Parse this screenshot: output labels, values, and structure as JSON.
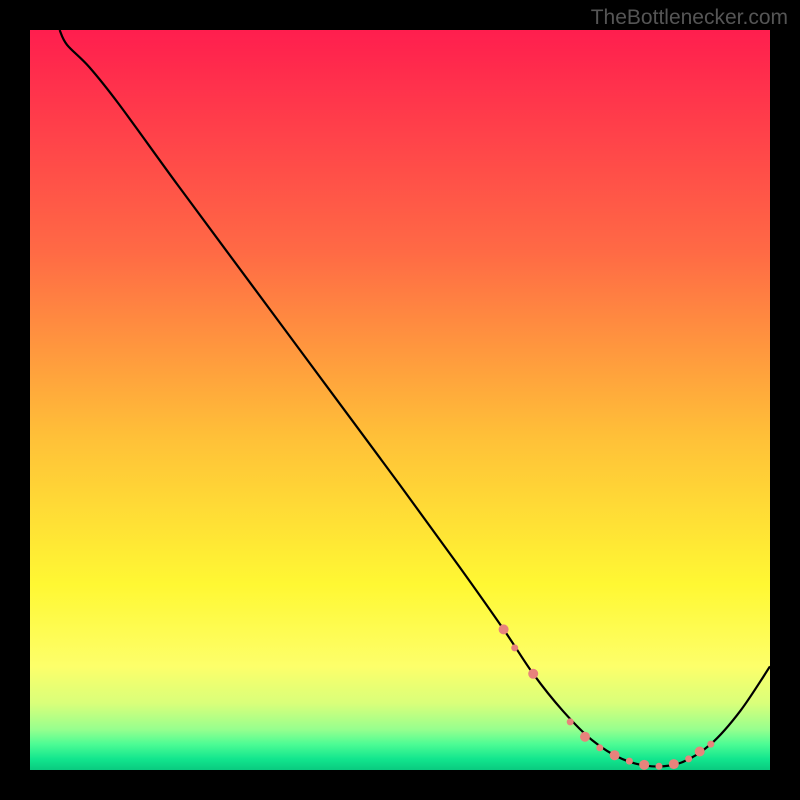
{
  "watermark": "TheBottlenecker.com",
  "chart_data": {
    "type": "line",
    "title": "",
    "xlabel": "",
    "ylabel": "",
    "xlim": [
      0,
      100
    ],
    "ylim": [
      0,
      100
    ],
    "series": [
      {
        "name": "bottleneck-curve",
        "color": "#000000",
        "x": [
          4,
          5,
          8,
          12,
          20,
          30,
          40,
          50,
          58,
          64,
          68,
          72,
          76,
          80,
          84,
          88,
          92,
          96,
          100
        ],
        "y": [
          100,
          98,
          95,
          90,
          79,
          65.5,
          52,
          38.5,
          27.5,
          19,
          13,
          8,
          4,
          1.5,
          0.5,
          1,
          3.5,
          8,
          14
        ]
      }
    ],
    "markers": {
      "name": "highlight-dots",
      "color": "#e8837c",
      "points": [
        {
          "x": 64,
          "y": 19,
          "r": 5
        },
        {
          "x": 65.5,
          "y": 16.5,
          "r": 3.5
        },
        {
          "x": 68,
          "y": 13,
          "r": 5
        },
        {
          "x": 73,
          "y": 6.5,
          "r": 3.5
        },
        {
          "x": 75,
          "y": 4.5,
          "r": 5
        },
        {
          "x": 77,
          "y": 3,
          "r": 3.5
        },
        {
          "x": 79,
          "y": 2,
          "r": 5
        },
        {
          "x": 81,
          "y": 1.2,
          "r": 3.5
        },
        {
          "x": 83,
          "y": 0.7,
          "r": 5
        },
        {
          "x": 85,
          "y": 0.5,
          "r": 3.5
        },
        {
          "x": 87,
          "y": 0.8,
          "r": 5
        },
        {
          "x": 89,
          "y": 1.5,
          "r": 3.5
        },
        {
          "x": 90.5,
          "y": 2.5,
          "r": 5
        },
        {
          "x": 92,
          "y": 3.5,
          "r": 3.5
        }
      ]
    },
    "gradient_stops": [
      {
        "offset": 0,
        "color": "#ff1e4e"
      },
      {
        "offset": 0.3,
        "color": "#ff6a45"
      },
      {
        "offset": 0.55,
        "color": "#ffc038"
      },
      {
        "offset": 0.75,
        "color": "#fff833"
      },
      {
        "offset": 0.86,
        "color": "#fdff6a"
      },
      {
        "offset": 0.91,
        "color": "#d9ff7a"
      },
      {
        "offset": 0.945,
        "color": "#97ff8e"
      },
      {
        "offset": 0.965,
        "color": "#4dfc94"
      },
      {
        "offset": 0.985,
        "color": "#12e68e"
      },
      {
        "offset": 1.0,
        "color": "#0aca7f"
      }
    ]
  }
}
